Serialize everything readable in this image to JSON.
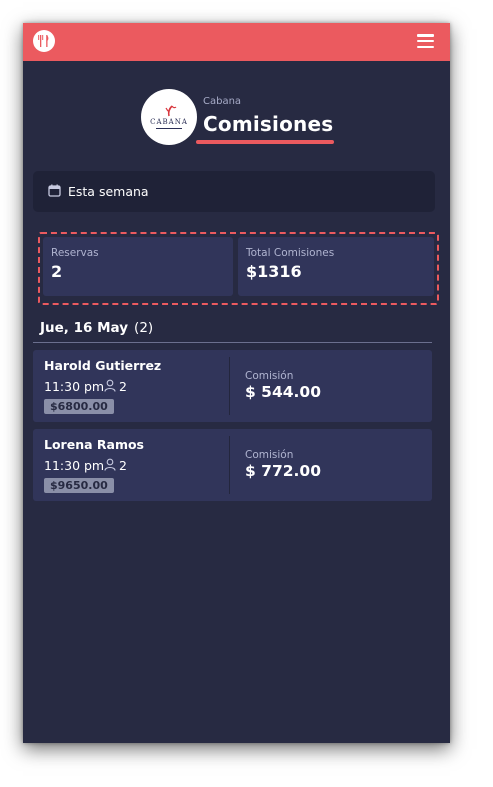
{
  "header": {
    "menu_icon": "hamburger-menu-icon",
    "logo_icon": "fork-knife-logo-icon",
    "accent_color": "#eb5a5f"
  },
  "venue": {
    "name": "Cabana",
    "logo_text": "CABANA"
  },
  "page": {
    "title": "Comisiones"
  },
  "filter": {
    "icon": "calendar-icon",
    "label": "Esta semana"
  },
  "summary": {
    "reservations_label": "Reservas",
    "reservations_value": "2",
    "commissions_label": "Total Comisiones",
    "commissions_value": "$1316"
  },
  "day": {
    "date": "Jue, 16 May",
    "count": "(2)"
  },
  "bookings": [
    {
      "name": "Harold Gutierrez",
      "time": "11:30 pm",
      "guests": "2",
      "amount": "$6800.00",
      "commission_label": "Comisión",
      "commission": "$ 544.00"
    },
    {
      "name": "Lorena Ramos",
      "time": "11:30 pm",
      "guests": "2",
      "amount": "$9650.00",
      "commission_label": "Comisión",
      "commission": "$ 772.00"
    }
  ]
}
